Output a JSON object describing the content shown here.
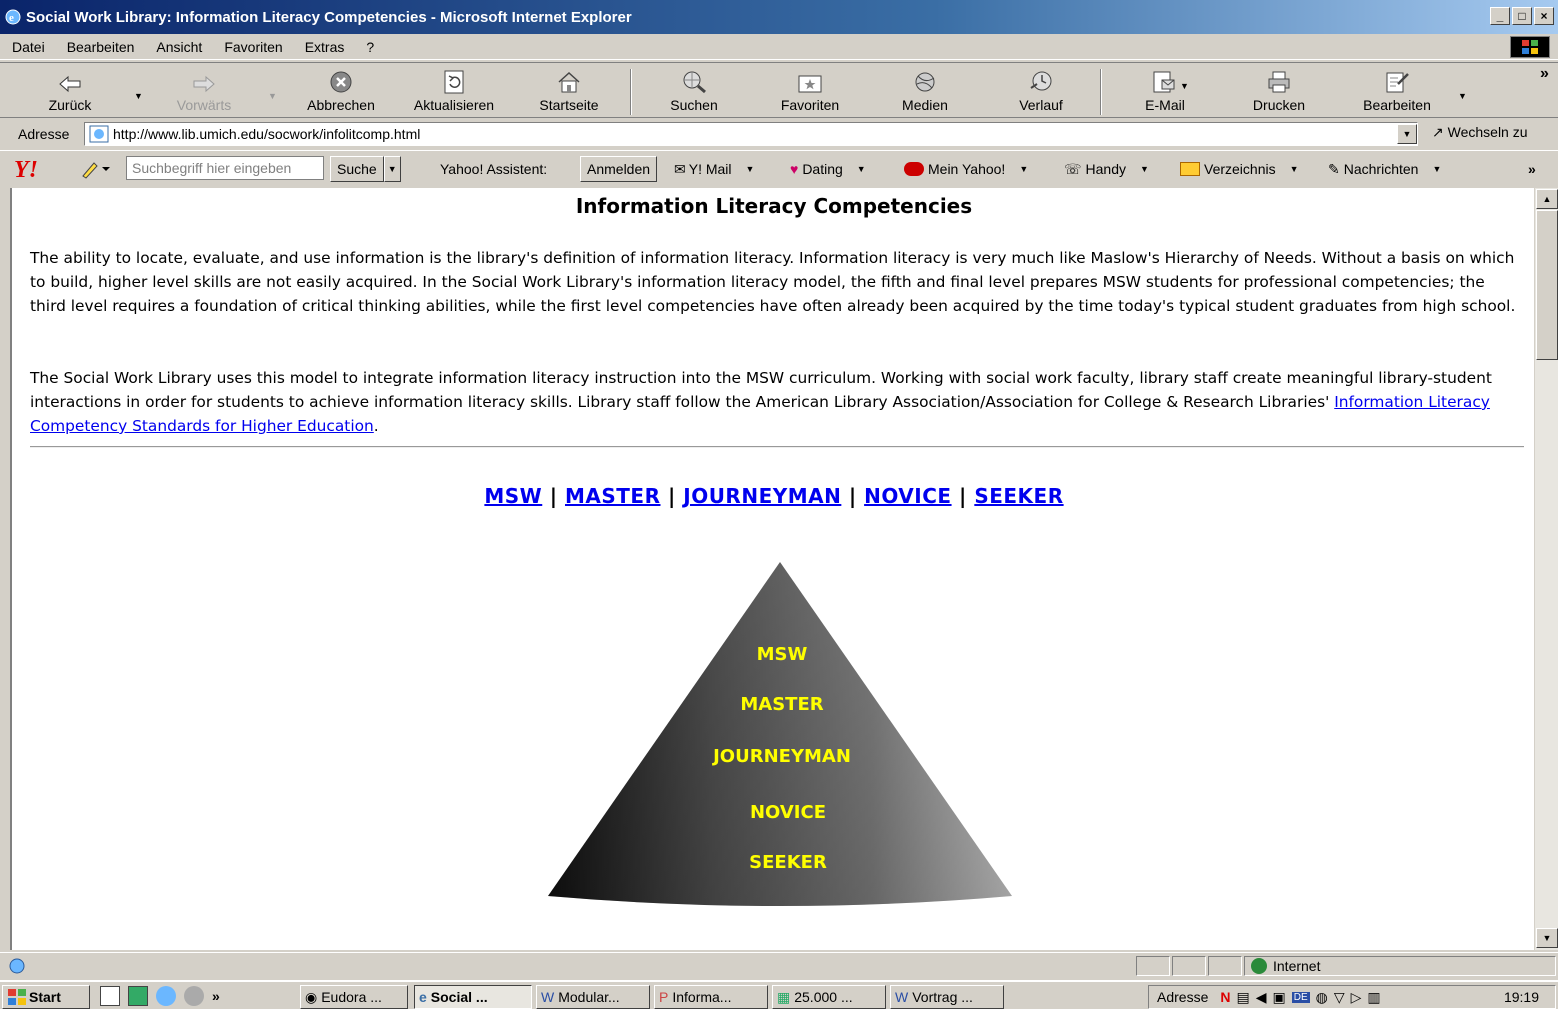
{
  "window": {
    "title": "Social Work Library: Information Literacy Competencies - Microsoft Internet Explorer",
    "buttons": [
      "_",
      "□",
      "×"
    ]
  },
  "menubar": [
    "Datei",
    "Bearbeiten",
    "Ansicht",
    "Favoriten",
    "Extras",
    "?"
  ],
  "toolbar": {
    "back": "Zurück",
    "forward": "Vorwärts",
    "stop": "Abbrechen",
    "refresh": "Aktualisieren",
    "home": "Startseite",
    "search": "Suchen",
    "favorites": "Favoriten",
    "media": "Medien",
    "history": "Verlauf",
    "mail": "E-Mail",
    "print": "Drucken",
    "edit": "Bearbeiten",
    "more": "»"
  },
  "address": {
    "label": "Adresse",
    "url": "http://www.lib.umich.edu/socwork/infolitcomp.html",
    "go": "Wechseln zu"
  },
  "yahoo": {
    "search_placeholder": "Suchbegriff hier eingeben",
    "search_button": "Suche",
    "assistant": "Yahoo! Assistent:",
    "signin": "Anmelden",
    "mail": "Y! Mail",
    "dating": "Dating",
    "myyahoo": "Mein Yahoo!",
    "mobile": "Handy",
    "directory": "Verzeichnis",
    "news": "Nachrichten",
    "more": "»"
  },
  "page": {
    "heading": "Information Literacy Competencies",
    "para1": "The ability to locate, evaluate, and use information is the library's definition of information literacy. Information literacy is very much like Maslow's Hierarchy of Needs. Without a basis on which to build, higher level skills are not easily acquired. In the Social Work Library's information literacy model, the fifth and final level prepares MSW students for professional competencies; the third level requires a foundation of critical thinking abilities, while the first level competencies have often already been acquired by the time today's typical student graduates from high school.",
    "para2_text": "The Social Work Library uses this model to integrate information literacy instruction into the MSW curriculum. Working with social work faculty, library staff create meaningful library-student interactions in order for students to achieve information literacy skills. Library staff follow the American Library Association/Association for College & Research Libraries' ",
    "para2_link": "Information Literacy Competency Standards for Higher Education",
    "para2_end": ".",
    "levels": [
      "MSW",
      "MASTER",
      "JOURNEYMAN",
      "NOVICE",
      "SEEKER"
    ],
    "separator": "|"
  },
  "status": {
    "zone": "Internet"
  },
  "taskbar": {
    "start": "Start",
    "more": "»",
    "tasks": [
      "Eudora ...",
      "Social ...",
      "Modular...",
      "Informa...",
      "25.000 ...",
      "Vortrag ..."
    ],
    "tray_label": "Adresse",
    "clock": "19:19"
  },
  "colors": {
    "link": "#0000ee",
    "pyramid_label": "#ffff00",
    "titlebar": "#0a246a"
  }
}
